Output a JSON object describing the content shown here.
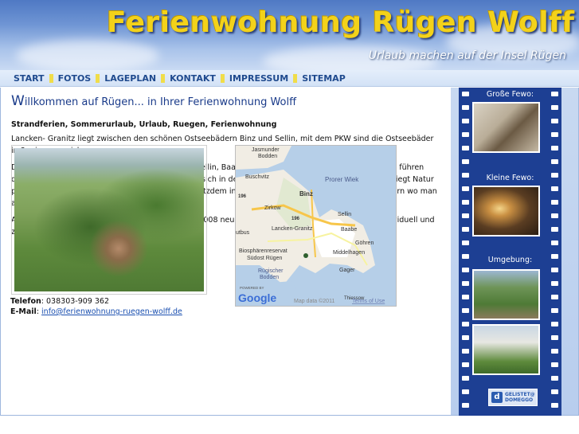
{
  "header": {
    "title": "Ferienwohnung Rügen Wolff",
    "subtitle": "Urlaub machen auf der Insel Rügen"
  },
  "nav": {
    "items": [
      {
        "label": "START"
      },
      {
        "label": "FOTOS"
      },
      {
        "label": "LAGEPLAN"
      },
      {
        "label": "KONTAKT"
      },
      {
        "label": "IMPRESSUM"
      },
      {
        "label": "SITEMAP"
      }
    ]
  },
  "main": {
    "heading_initial": "W",
    "heading_rest": "illkommen auf Rügen... in Ihrer Ferienwohnung Wolff",
    "keywords": "Strandferien, Sommerurlaub, Urlaub, Ruegen, Ferienwohnung",
    "paragraphs": [
      "Lancken- Granitz liegt zwischen den schönen Ostseebädern Binz und Sellin, mit dem PKW sind die Ostseebäder in 8 min zu erreichen.",
      "Die Rad und Wanderwege sind in Richtung Binz, Sellin, Baabe, Göhren und Putbus gut ausgebaut und führen durch die Natur. Eine Fahrradvermietung befindet sich in der Nähe. Umliegend von Lancken- Granitz liegt Natur pur somit ist Ruhe und Erholung garantiert und trotzdem in zentraler Umgebung von den Ostseebädern wo man auch mal was erleben kann.",
      "Ausstattung: Unsere 2 Ferienwohnungen wurden 2008 neu saniert und modernisiert. Gemütlich, individuell und zugleich komfortabel eingerichtet."
    ],
    "contact": {
      "phone_label": "Telefon",
      "phone": ": 038303-909 362",
      "email_label": "E-Mail",
      "email_sep": ": ",
      "email": "info@ferienwohnung-ruegen-wolff.de"
    }
  },
  "map": {
    "labels": {
      "jasmunder": "Jasmunder",
      "bodden1": "Bodden",
      "buschvitz": "Buschvitz",
      "prorer": "Prorer Wiek",
      "binz": "Binz",
      "zirkow": "Zirkow",
      "road196a": "196",
      "road196b": "196",
      "sellin": "Sellin",
      "putbus": "utbus",
      "lancken": "Lancken-Granitz",
      "baabe": "Baabe",
      "goehren": "Göhren",
      "bio1": "Biosphärenreservat",
      "bio2": "Südost Rügen",
      "middelhagen": "Middelhagen",
      "ruegischer": "Rügischer",
      "bodden2": "Bodden",
      "gager": "Gager",
      "thiessow": "Thiessow",
      "powered": "POWERED BY",
      "google": "Google",
      "mapdata": "Map data ©2011",
      "terms": "Terms of Use"
    }
  },
  "sidebar": {
    "sections": [
      {
        "label": "Große Fewo:"
      },
      {
        "label": "Kleine Fewo:"
      },
      {
        "label": "Umgebung:"
      }
    ],
    "badge": {
      "letter": "d",
      "line1": "GELISTET@",
      "line2": "DOMEGGO"
    }
  }
}
